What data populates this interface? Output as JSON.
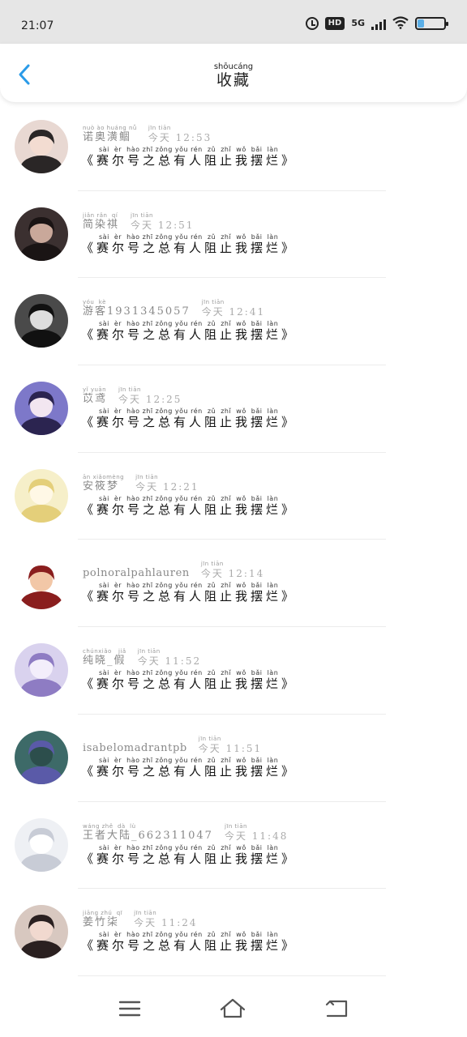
{
  "status_bar": {
    "time": "21:07",
    "hd": "HD",
    "network": "5G",
    "battery_level": 0.25
  },
  "header": {
    "title": "收藏",
    "title_pinyin": "shōucáng",
    "back_icon": "chevron-left-icon",
    "accent": "#2a9be8"
  },
  "message": {
    "pinyin": "sài  èr  hào zhī zǒng yǒu rén  zǔ  zhǐ  wǒ  bǎi  làn",
    "text": "《赛尔号之总有人阻止我摆烂》"
  },
  "items": [
    {
      "name": "诺奥潢鲴",
      "name_pinyin": "nuò ào huáng nǚ",
      "time": "今天 12:53",
      "time_pinyin": "jīn tiān"
    },
    {
      "name": "简染祺",
      "name_pinyin": "jiǎn rǎn  qí",
      "time": "今天 12:51",
      "time_pinyin": "jīn tiān"
    },
    {
      "name": "游客1931345057",
      "name_pinyin": "yóu  kè",
      "time": "今天 12:41",
      "time_pinyin": "jīn tiān"
    },
    {
      "name": "苡鸢",
      "name_pinyin": "yǐ yuān",
      "time": "今天 12:25",
      "time_pinyin": "jīn tiān"
    },
    {
      "name": "安筱梦",
      "name_pinyin": "ān xiǎomèng",
      "time": "今天 12:21",
      "time_pinyin": "jīn tiān"
    },
    {
      "name": "polnoralpahlauren",
      "name_pinyin": "",
      "time": "今天 12:14",
      "time_pinyin": "jīn tiān"
    },
    {
      "name": "纯晓_假",
      "name_pinyin": "chúnxiǎo   jiǎ",
      "time": "今天 11:52",
      "time_pinyin": "jīn tiān"
    },
    {
      "name": "isabelomadrantpb",
      "name_pinyin": "",
      "time": "今天 11:51",
      "time_pinyin": "jīn tiān"
    },
    {
      "name": "王者大陆_662311047",
      "name_pinyin": "wáng zhě  dà  lù",
      "time": "今天 11:48",
      "time_pinyin": "jīn tiān"
    },
    {
      "name": "姜竹柒",
      "name_pinyin": "jiāng zhú  qī",
      "time": "今天 11:24",
      "time_pinyin": "jīn tiān"
    }
  ],
  "navbar": {
    "menu_icon": "menu-icon",
    "home_icon": "home-icon",
    "back_icon": "back-arrow-icon"
  }
}
